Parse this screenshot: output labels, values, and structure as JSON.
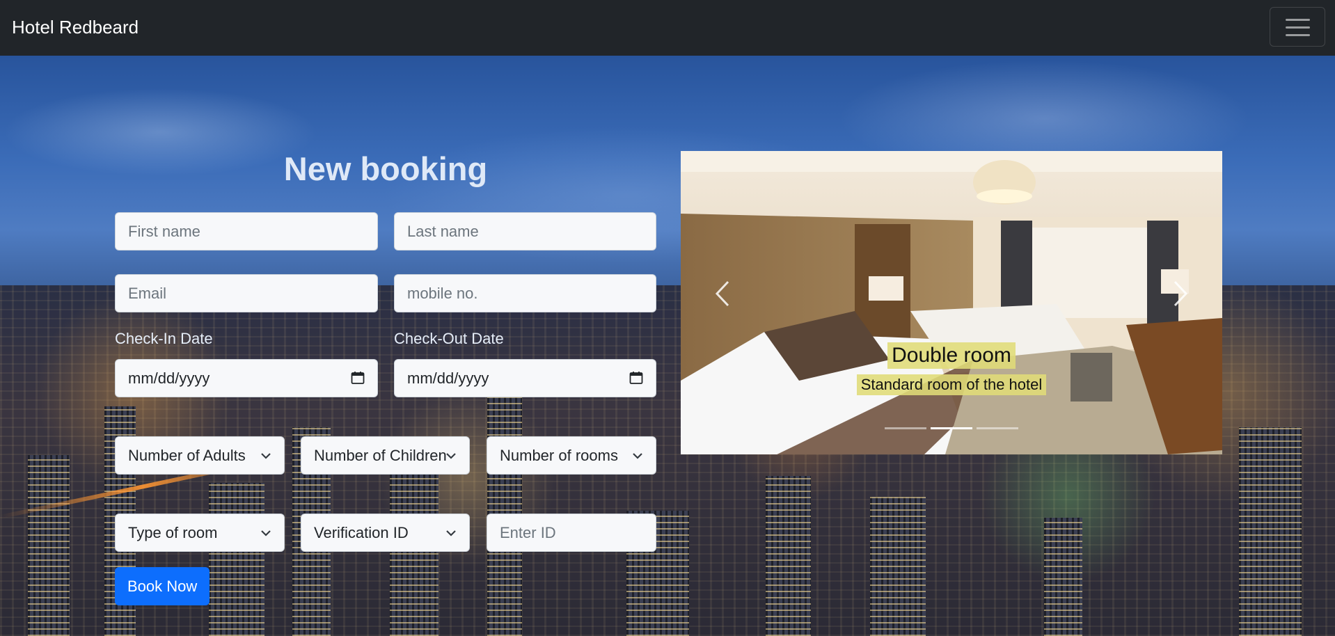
{
  "navbar": {
    "brand": "Hotel Redbeard",
    "toggler_icon": "hamburger-icon"
  },
  "form": {
    "title": "New booking",
    "first_name": {
      "placeholder": "First name"
    },
    "last_name": {
      "placeholder": "Last name"
    },
    "email": {
      "placeholder": "Email"
    },
    "mobile": {
      "placeholder": "mobile no."
    },
    "checkin": {
      "label": "Check-In Date",
      "value": "mm/dd/yyyy"
    },
    "checkout": {
      "label": "Check-Out Date",
      "value": "mm/dd/yyyy"
    },
    "adults": {
      "selected": "Number of Adults"
    },
    "children": {
      "selected": "Number of Children"
    },
    "rooms": {
      "selected": "Number of rooms"
    },
    "room_type": {
      "selected": "Type of room"
    },
    "verification": {
      "selected": "Verification ID"
    },
    "id_number": {
      "placeholder": "Enter ID"
    },
    "submit_label": "Book Now"
  },
  "carousel": {
    "slide": {
      "title": "Double room",
      "subtitle": "Standard room of the hotel"
    },
    "indicators": 3,
    "active_indicator": 1
  },
  "colors": {
    "navbar": "#212529",
    "primary": "#0d6efd",
    "caption_bg": "#e0dc78"
  }
}
